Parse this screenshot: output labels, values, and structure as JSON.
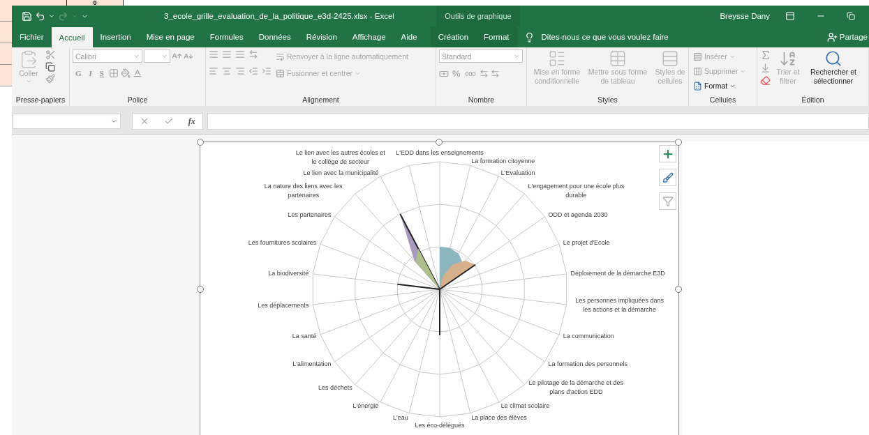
{
  "background_sheet": {
    "cell": "0"
  },
  "window": {
    "title": "3_ecole_grille_evaluation_de_la_politique_e3d-2425.xlsx  -  Excel",
    "context_group": "Outils de graphique",
    "user": "Breysse Dany"
  },
  "tabs": [
    {
      "label": "Fichier",
      "selected": false,
      "kind": "main"
    },
    {
      "label": "Accueil",
      "selected": true,
      "kind": "main"
    },
    {
      "label": "Insertion",
      "selected": false,
      "kind": "main"
    },
    {
      "label": "Mise en page",
      "selected": false,
      "kind": "main"
    },
    {
      "label": "Formules",
      "selected": false,
      "kind": "main"
    },
    {
      "label": "Données",
      "selected": false,
      "kind": "main"
    },
    {
      "label": "Révision",
      "selected": false,
      "kind": "main"
    },
    {
      "label": "Affichage",
      "selected": false,
      "kind": "main"
    },
    {
      "label": "Aide",
      "selected": false,
      "kind": "main"
    },
    {
      "label": "Création",
      "selected": false,
      "kind": "context"
    },
    {
      "label": "Format",
      "selected": false,
      "kind": "context"
    }
  ],
  "tell_me": "Dites-nous ce que vous voulez faire",
  "share": "Partage",
  "ribbon": {
    "clipboard": {
      "label": "Presse-papiers",
      "paste": {
        "label": "Coller",
        "disabled": true
      }
    },
    "font": {
      "label": "Police",
      "font_name": "Calibri",
      "style_buttons": [
        "G",
        "I",
        "S"
      ]
    },
    "alignment": {
      "label": "Alignement",
      "wrap": {
        "label": "Renvoyer à la ligne automatiquement",
        "disabled": true
      },
      "merge": {
        "label": "Fusionner et centrer",
        "disabled": true
      }
    },
    "number": {
      "label": "Nombre",
      "format": "Standard",
      "percent": "%",
      "thousands": "000"
    },
    "styles": {
      "label": "Styles",
      "commands": [
        {
          "label": "Mise en forme conditionnelle",
          "disabled": true
        },
        {
          "label": "Mettre sous forme de tableau",
          "disabled": true
        },
        {
          "label": "Styles de cellules",
          "disabled": true
        }
      ]
    },
    "cells": {
      "label": "Cellules",
      "commands": [
        {
          "label": "Insérer",
          "disabled": true
        },
        {
          "label": "Supprimer",
          "disabled": true
        },
        {
          "label": "Format",
          "disabled": false
        }
      ]
    },
    "editing": {
      "label": "Édition",
      "commands": [
        {
          "label": "Trier et filtrer",
          "disabled": true
        },
        {
          "label": "Rechercher et sélectionner",
          "disabled": false
        }
      ]
    }
  },
  "formula_bar": {
    "fx": "fx"
  },
  "radar_labels_right": [
    "L'EDD dans les enseignements",
    "La formation citoyenne",
    "L'Evaluation",
    "L'engagement pour une école plus durable",
    "ODD et agenda 2030",
    "Le projet d'Ecole",
    "Déploiement de la démarche E3D",
    "Les personnes impliquées dans les actions et la démarche",
    "La communication",
    "La formation des personnels",
    "Le pilotage de la démarche et des plans d'action EDD",
    "Le climat scolaire",
    "La place des élèves",
    "Les éco-délégués"
  ],
  "radar_labels_left": [
    "Le lien avec les autres écoles et le collège de secteur",
    "Le lien avec la municipalité",
    "La nature des liens avec les partenaires",
    "Les partenaires",
    "Les fournitures scolaires",
    "La biodiversité",
    "Les déplacements",
    "La santé",
    "L'alimentation",
    "Les déchets",
    "L'énergie",
    "L'eau"
  ]
}
